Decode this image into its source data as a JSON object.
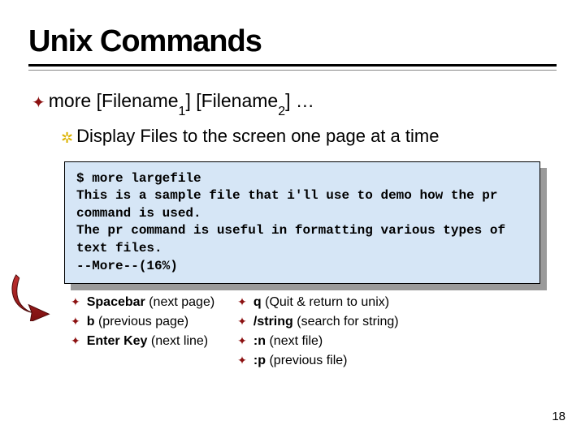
{
  "title": "Unix Commands",
  "cmd": {
    "name": "more",
    "args": "[Filename",
    "sub1": "1",
    "mid": "] [Filename",
    "sub2": "2",
    "tail": "] …"
  },
  "desc": "Display Files to the screen one page at a time",
  "code": "$ more largefile\nThis is a sample file that i'll use to demo how the pr command is used.\nThe pr command is useful in formatting various types of text files.\n--More--(16%)",
  "keys_left": [
    {
      "k": "Spacebar",
      "d": " (next page)"
    },
    {
      "k": "b",
      "d": " (previous page)"
    },
    {
      "k": "Enter Key",
      "d": " (next line)"
    }
  ],
  "keys_right": [
    {
      "k": "q",
      "d": " (Quit & return to unix)"
    },
    {
      "k": "/string",
      "d": " (search for string)"
    },
    {
      "k": ":n",
      "d": " (next file)"
    },
    {
      "k": ":p",
      "d": " (previous file)"
    }
  ],
  "page": "18",
  "colors": {
    "accent": "#8c1111",
    "gold": "#dcb300",
    "codebg": "#d6e6f6"
  }
}
